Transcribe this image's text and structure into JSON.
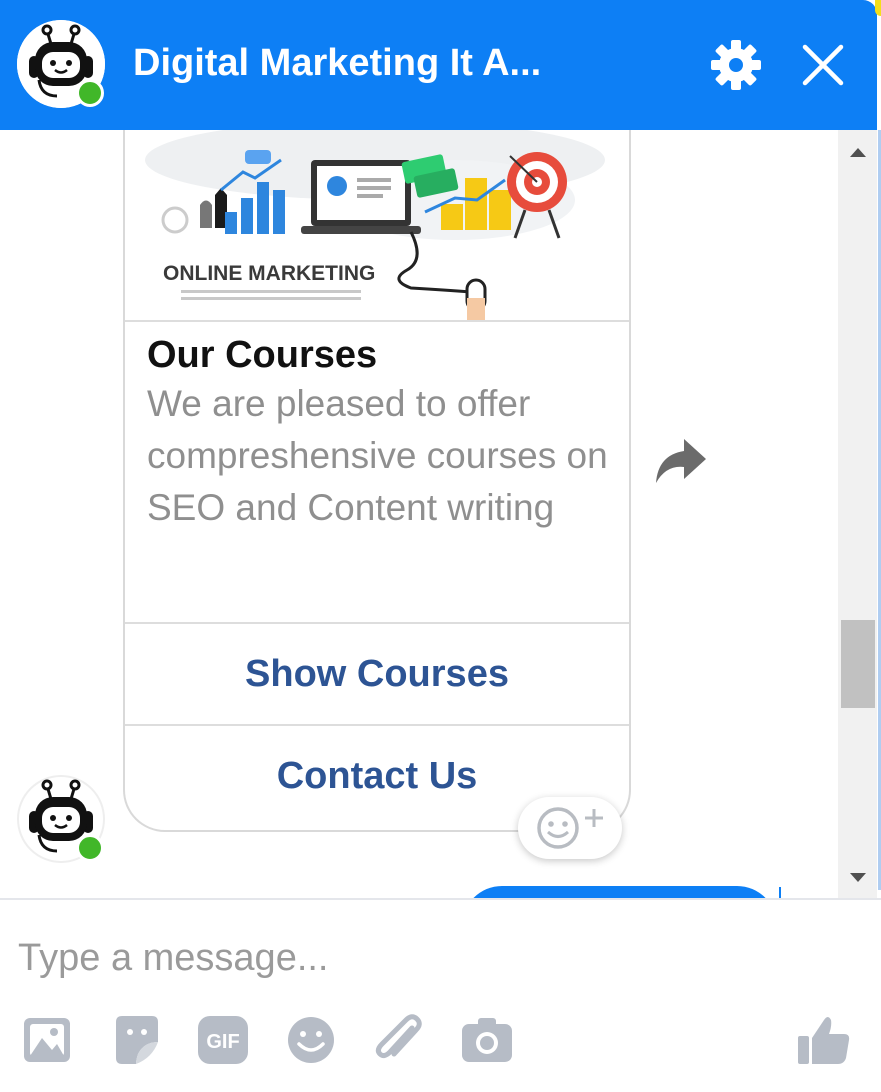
{
  "header": {
    "title": "Digital Marketing It A..."
  },
  "card": {
    "image_caption": "ONLINE MARKETING",
    "title": "Our Courses",
    "subtitle": "We are pleased to offer compreshensive courses on SEO and Content writing",
    "buttons": [
      "Show Courses",
      "Contact Us"
    ]
  },
  "composer": {
    "placeholder": "Type a message..."
  },
  "icons": {
    "header": [
      "bot-avatar-icon",
      "gear-icon",
      "close-icon"
    ],
    "toolbar": [
      "image-icon",
      "sticker-icon",
      "gif-icon",
      "emoji-icon",
      "attachment-icon",
      "camera-icon",
      "thumbs-up-icon"
    ],
    "gif_label": "GIF"
  },
  "colors": {
    "brand_blue": "#0d7ff5",
    "button_text": "#2d5494",
    "online_green": "#41b729",
    "toolbar_gray": "#b6bcc6"
  }
}
